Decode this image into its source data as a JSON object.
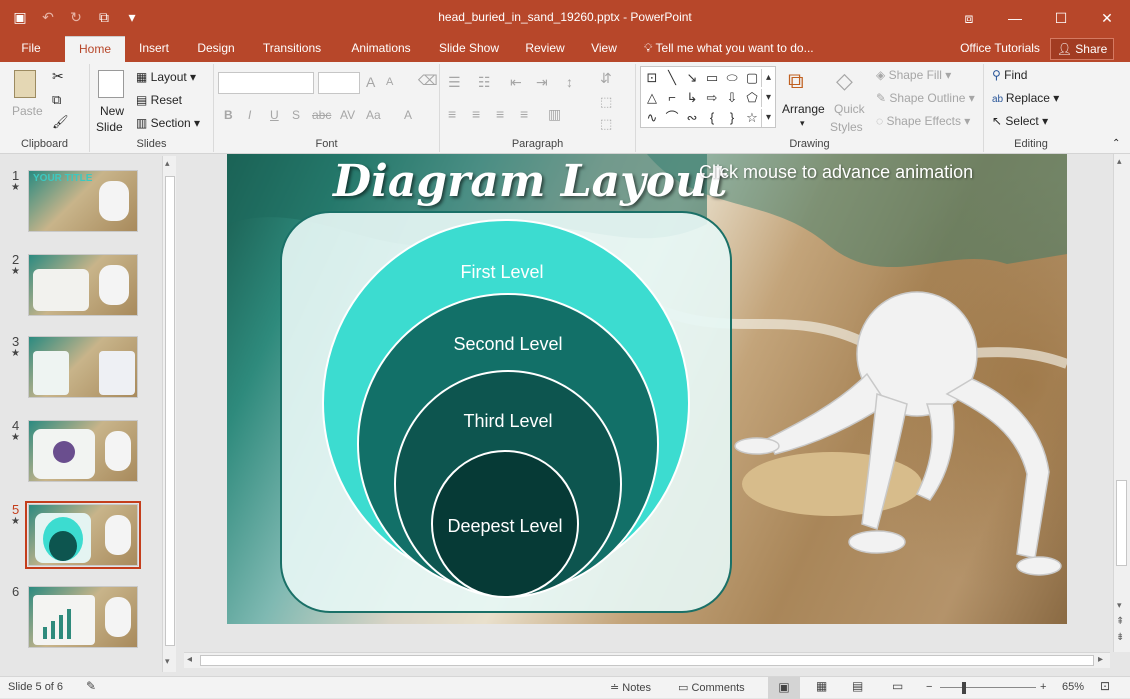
{
  "window": {
    "title": "head_buried_in_sand_19260.pptx - PowerPoint",
    "qat": [
      {
        "name": "save-icon",
        "glyph": "🖫"
      },
      {
        "name": "undo-icon",
        "glyph": "↶"
      },
      {
        "name": "redo-icon",
        "glyph": "↻"
      },
      {
        "name": "present-from-start-icon",
        "glyph": "⧉"
      },
      {
        "name": "customize-qat-icon",
        "glyph": "▾"
      }
    ],
    "controls": [
      "⧈",
      "—",
      "☐",
      "✕"
    ]
  },
  "tabs": [
    "File",
    "Home",
    "Insert",
    "Design",
    "Transitions",
    "Animations",
    "Slide Show",
    "Review",
    "View"
  ],
  "active_tab": "Home",
  "tell_me": "Tell me what you want to do...",
  "office_tutorials": "Office Tutorials",
  "share": "Share",
  "ribbon": {
    "clipboard": {
      "label": "Clipboard",
      "paste": "Paste"
    },
    "slides": {
      "label": "Slides",
      "new_slide_1": "New",
      "new_slide_2": "Slide",
      "layout": "Layout",
      "reset": "Reset",
      "section": "Section"
    },
    "font": {
      "label": "Font",
      "bold": "B",
      "italic": "I",
      "underline": "U",
      "shadow": "S",
      "strike": "abc",
      "spacing": "AV",
      "case": "Aa",
      "grow": "A",
      "shrink": "A"
    },
    "paragraph": {
      "label": "Paragraph"
    },
    "drawing": {
      "label": "Drawing",
      "arrange": "Arrange",
      "quick_styles_1": "Quick",
      "quick_styles_2": "Styles",
      "shape_fill": "Shape Fill",
      "shape_outline": "Shape Outline",
      "shape_effects": "Shape Effects"
    },
    "editing": {
      "label": "Editing",
      "find": "Find",
      "replace": "Replace",
      "select": "Select"
    }
  },
  "thumbnails": [
    {
      "num": "1",
      "star": "★",
      "caption": "YOUR TITLE"
    },
    {
      "num": "2",
      "star": "★",
      "caption": ""
    },
    {
      "num": "3",
      "star": "★",
      "caption": ""
    },
    {
      "num": "4",
      "star": "★",
      "caption": ""
    },
    {
      "num": "5",
      "star": "★",
      "caption": ""
    },
    {
      "num": "6",
      "star": "",
      "caption": ""
    }
  ],
  "selected_slide": 5,
  "slide": {
    "title": "Diagram Layout",
    "subtitle": "Click mouse to advance animation",
    "levels": [
      "First Level",
      "Second Level",
      "Third Level",
      "Deepest Level"
    ],
    "colors": {
      "first": "#3cdcd0",
      "second": "#127068",
      "third": "#0d554f",
      "deepest": "#063a36"
    }
  },
  "status": {
    "slide_of": "Slide 5 of 6",
    "notes": "Notes",
    "comments": "Comments",
    "zoom": "65%"
  }
}
